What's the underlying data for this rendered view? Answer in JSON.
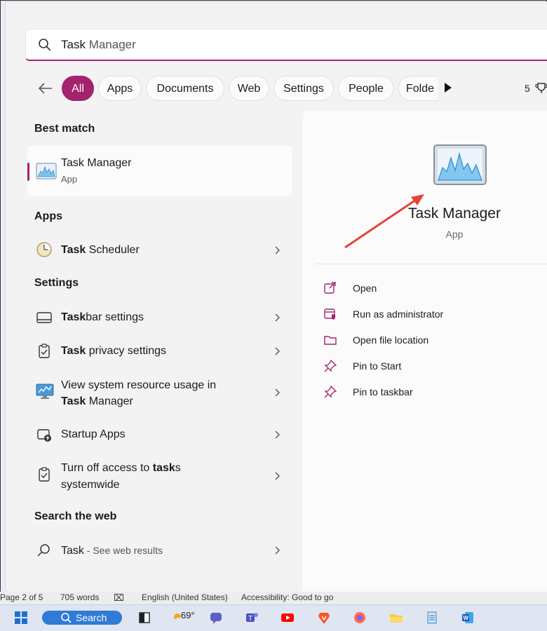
{
  "search": {
    "query_prefix": "Task",
    "query_suffix": " Manager"
  },
  "filters": [
    {
      "label": "All",
      "active": true
    },
    {
      "label": "Apps"
    },
    {
      "label": "Documents"
    },
    {
      "label": "Web"
    },
    {
      "label": "Settings"
    },
    {
      "label": "People"
    },
    {
      "label": "Folde"
    }
  ],
  "rewards_count": "5",
  "sections": {
    "best_match": "Best match",
    "apps": "Apps",
    "settings": "Settings",
    "search_web": "Search the web"
  },
  "best_match": {
    "title": "Task Manager",
    "subtitle": "App"
  },
  "apps": [
    {
      "bold": "Task",
      "rest": " Scheduler"
    }
  ],
  "settings": [
    {
      "bold": "Task",
      "rest": "bar settings"
    },
    {
      "bold": "Task",
      "rest": " privacy settings"
    },
    {
      "line1": "View system resource usage in",
      "line2_bold": "Task",
      "line2_rest": " Manager"
    },
    {
      "rest": "Startup Apps"
    },
    {
      "line1_pre": "Turn off access to ",
      "line1_bold": "task",
      "line1_post": "s",
      "line2_rest": "systemwide"
    }
  ],
  "web": {
    "bold": "Task",
    "rest": " - See web results"
  },
  "detail": {
    "title": "Task Manager",
    "subtitle": "App",
    "actions": [
      "Open",
      "Run as administrator",
      "Open file location",
      "Pin to Start",
      "Pin to taskbar"
    ]
  },
  "statusbar": {
    "page": "Page 2 of 5",
    "words": "705 words",
    "language": "English (United States)",
    "accessibility": "Accessibility: Good to go"
  },
  "taskbar": {
    "search_label": "Search",
    "weather": "69°"
  },
  "colors": {
    "accent": "#a3236e",
    "arrow": "#e8413c",
    "taskbar_search": "#2f7bd6"
  }
}
